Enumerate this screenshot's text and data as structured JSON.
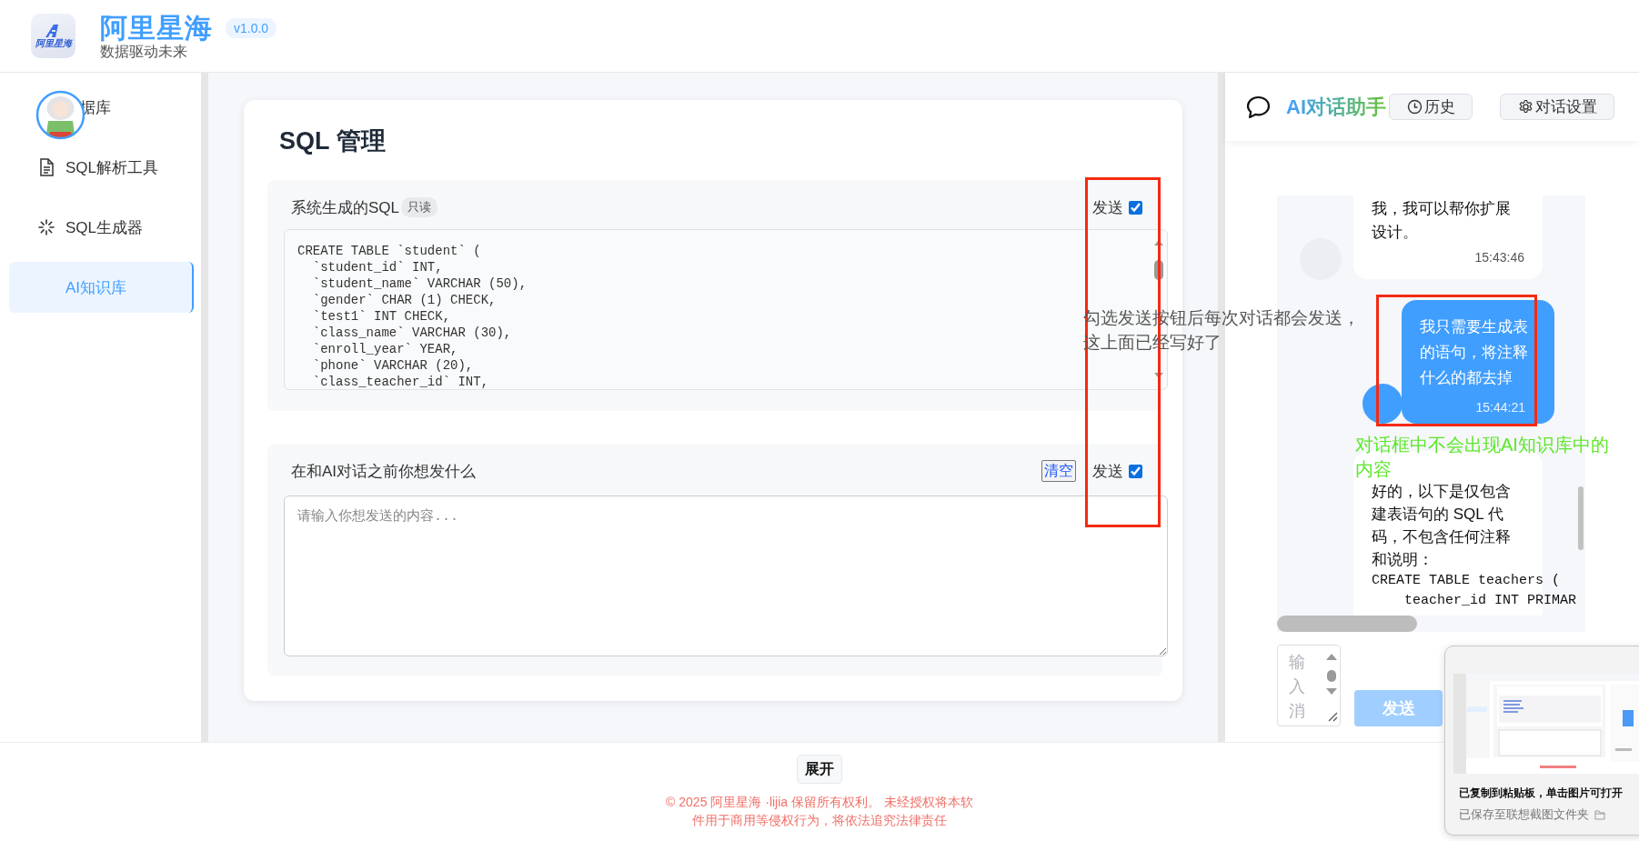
{
  "header": {
    "logo_text": "阿里星海",
    "title": "阿里星海",
    "version": "v1.0.0",
    "subtitle": "数据驱动未来"
  },
  "sidebar": {
    "items": [
      {
        "kind": "covered",
        "label": "据库",
        "selected": false
      },
      {
        "kind": "document",
        "label": "SQL解析工具",
        "selected": false
      },
      {
        "kind": "sparkle",
        "label": "SQL生成器",
        "selected": false
      },
      {
        "kind": "plain",
        "label": "AI知识库",
        "selected": true
      }
    ]
  },
  "sql_panel": {
    "title": "SQL 管理",
    "sections": [
      {
        "kind": "code",
        "label": "系统生成的SQL",
        "badge": "只读",
        "send_label": "发送",
        "send": true,
        "code_lines": [
          "CREATE TABLE `student` (",
          "  `student_id` INT,",
          "  `student_name` VARCHAR (50),",
          "  `gender` CHAR (1) CHECK,",
          "  `test1` INT CHECK,",
          "  `class_name` VARCHAR (30),",
          "  `enroll_year` YEAR,",
          "  `phone` VARCHAR (20),",
          "  `class_teacher_id` INT,"
        ]
      },
      {
        "kind": "input",
        "label": "在和AI对话之前你想发什么",
        "clear_button": "清空",
        "send_label": "发送",
        "send": true,
        "placeholder": "请输入你想发送的内容..."
      }
    ]
  },
  "chat": {
    "title": "AI对话助手",
    "buttons": [
      {
        "kind": "history",
        "label": "历史"
      },
      {
        "kind": "settings",
        "label": "对话设置"
      }
    ],
    "messages": [
      {
        "kind": "ai",
        "text": "我，我可以帮你扩展设计。",
        "time": "15:43:46"
      },
      {
        "kind": "user",
        "text": "我只需要生成表的语句，将注释什么的都去掉",
        "time": "15:44:21"
      },
      {
        "kind": "ai",
        "text": "好的，以下是仅包含建表语句的 SQL 代码，不包含任何注释和说明：",
        "code": [
          "CREATE TABLE teachers (",
          "    teacher_id INT PRIMAR"
        ]
      }
    ],
    "input_placeholder": "输入消",
    "send_button": "发送"
  },
  "footer": {
    "expand_button": "展开",
    "copyright": "© 2025 阿里星海 ·lijia 保留所有权利。 未经授权将本软件用于商用等侵权行为，将依法追究法律责任"
  },
  "annotations": [
    {
      "kind": "frame"
    },
    {
      "kind": "note",
      "color": "#555555",
      "text": "勾选发送按钮后每次对话都会发送，这上面已经写好了"
    },
    {
      "kind": "frame"
    },
    {
      "kind": "note",
      "color": "#5de82a",
      "text": "对话框中不会出现AI知识库中的内容"
    }
  ],
  "toast": {
    "title": "已复制到粘贴板，单击图片可打开",
    "subtitle": "已保存至联想截图文件夹"
  }
}
